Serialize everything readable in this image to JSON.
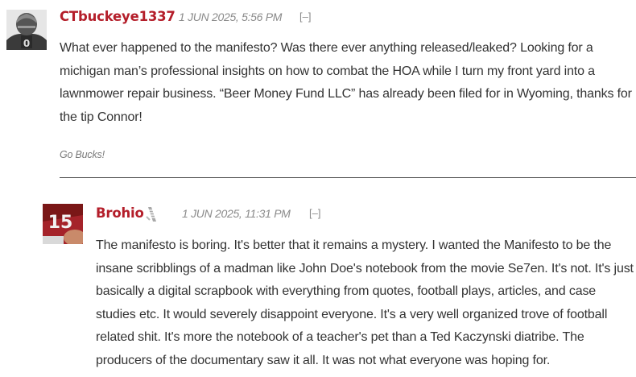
{
  "comments": [
    {
      "author": "CTbuckeye1337",
      "date": "1 JUN 2025, 5:56 PM",
      "toggle": "[–]",
      "avatar_icon": "football-player-avatar-icon",
      "body": "What ever happened to the manifesto? Was there ever anything released/leaked? Looking for a michigan man’s professional insights on how to combat the HOA while I turn my front yard into a lawnmower repair business. “Beer Money Fund LLC” has already been filed for in Wyoming, thanks for the tip Connor!",
      "signature": "Go Bucks!"
    },
    {
      "author": "Brohio",
      "date": "1 JUN 2025, 11:31 PM",
      "toggle": "[–]",
      "avatar_icon": "jersey-15-player-avatar-icon",
      "rank_icon": "rank-badge-icon",
      "body": "The manifesto is boring. It's better that it remains a mystery. I wanted the Manifesto to be the insane scribblings of a madman like John Doe's notebook from the movie Se7en. It's not. It's just basically a digital scrapbook with everything from quotes, football plays, articles, and case studies etc. It would severely disappoint everyone. It's a very well organized trove of football related shit. It's more the notebook of a teacher's pet than a Ted Kaczynski diatribe. The producers of the documentary saw it all. It was not what everyone was hoping for."
    }
  ],
  "colors": {
    "author": "#b41e2a",
    "meta": "#8a8a8a",
    "text": "#333333",
    "divider": "#555555"
  }
}
